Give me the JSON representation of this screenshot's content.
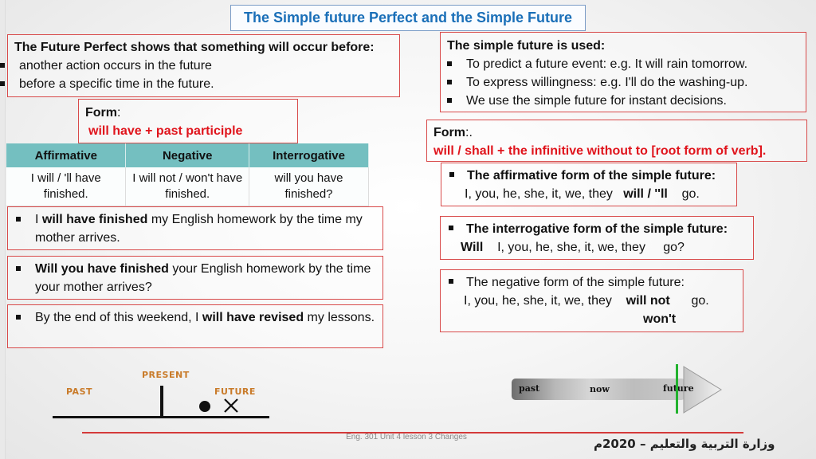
{
  "title": "The Simple future Perfect and the Simple Future",
  "future_perfect": {
    "heading": "The Future Perfect shows that something will occur before:",
    "bullets": [
      "another action occurs in the future",
      "before a specific time in the future."
    ],
    "form_label": "Form",
    "form_colon": ":",
    "form_rule": "will have + past participle"
  },
  "table": {
    "headers": [
      "Affirmative",
      "Negative",
      "Interrogative"
    ],
    "row": [
      [
        "I will / 'll have",
        "finished."
      ],
      [
        "I will not / won't have",
        "finished."
      ],
      [
        "will you have",
        "finished?"
      ]
    ]
  },
  "examples": [
    {
      "pre": "I ",
      "bold": "will have finished",
      "post": " my English homework by the time my mother arrives."
    },
    {
      "pre": "",
      "bold": "Will you have finished",
      "post": " your English homework by the time your mother arrives?"
    },
    {
      "pre": "By the end of this weekend, I ",
      "bold": "will have revised",
      "post": " my lessons."
    }
  ],
  "simple_future": {
    "heading": "The simple future is used:",
    "bullets": [
      "To predict a future event: e.g. It will rain tomorrow.",
      "To express willingness: e.g. I'll do the washing-up.",
      "We use the simple future for instant decisions."
    ],
    "form_label": "Form",
    "form_colon": ":.",
    "form_rule": "will / shall + the infinitive without to [root form of verb]."
  },
  "affirmative": {
    "heading": "The affirmative form of the simple future:",
    "subject": "I, you, he, she, it, we, they",
    "aux": "will / ''ll",
    "verb": "go."
  },
  "interrogative": {
    "heading": "The interrogative form of the simple future:",
    "aux": "Will",
    "subject": "I, you, he, she, it, we, they",
    "verb": "go?"
  },
  "negative": {
    "heading": "The negative form of the simple future:",
    "subject": "I, you, he, she, it, we, they",
    "aux": "will not",
    "verb": "go.",
    "contraction": "won't"
  },
  "timeline_left": {
    "present": "PRESENT",
    "past": "PAST",
    "future": "FUTURE"
  },
  "timeline_right": {
    "past": "past",
    "now": "now",
    "future": "future"
  },
  "footer": {
    "course": "Eng. 301 Unit 4 lesson 3 Changes",
    "ministry": "وزارة التربية والتعليم – 2020م"
  },
  "colors": {
    "accent_red": "#e0141c",
    "title_blue": "#1a6fb8",
    "table_header": "#74bfc0",
    "timeline_label": "#c97b2a",
    "marker_green": "#22b22e"
  }
}
